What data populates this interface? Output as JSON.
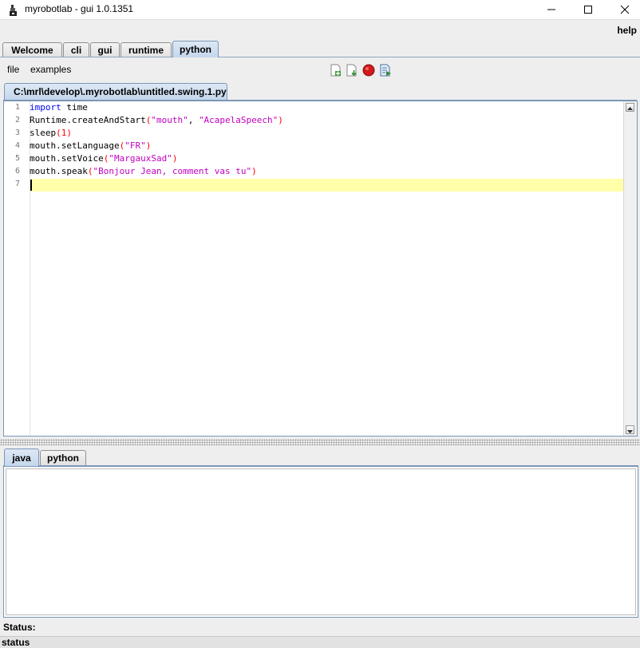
{
  "window": {
    "title": "myrobotlab - gui 1.0.1351",
    "help_label": "help"
  },
  "tabs": [
    {
      "label": "Welcome"
    },
    {
      "label": "cli"
    },
    {
      "label": "gui"
    },
    {
      "label": "runtime"
    },
    {
      "label": "python",
      "active": true
    }
  ],
  "menu": {
    "file_label": "file",
    "examples_label": "examples",
    "toolbar_icons": [
      "new-script-icon",
      "open-script-icon",
      "stop-icon",
      "execute-icon"
    ]
  },
  "editor": {
    "file_tab": "C:\\mrl\\develop\\.myrobotlab\\untitled.swing.1.py",
    "line_numbers": [
      "1",
      "2",
      "3",
      "4",
      "5",
      "6",
      "7"
    ],
    "lines": [
      "import time",
      "Runtime.createAndStart(\"mouth\", \"AcapelaSpeech\")",
      "sleep(1)",
      "mouth.setLanguage(\"FR\")",
      "mouth.setVoice(\"MargauxSad\")",
      "mouth.speak(\"Bonjour Jean, comment vas tu\")",
      ""
    ],
    "current_line": 7
  },
  "output": {
    "tabs": [
      {
        "label": "java",
        "active": true
      },
      {
        "label": "python"
      }
    ]
  },
  "status": {
    "label": "Status:",
    "bar_text": "status"
  },
  "colors": {
    "keyword": "#0000ff",
    "string": "#c000c0",
    "paren": "#ff0000",
    "current_line": "#ffffaa",
    "active_tab": "#c5d7ec"
  }
}
